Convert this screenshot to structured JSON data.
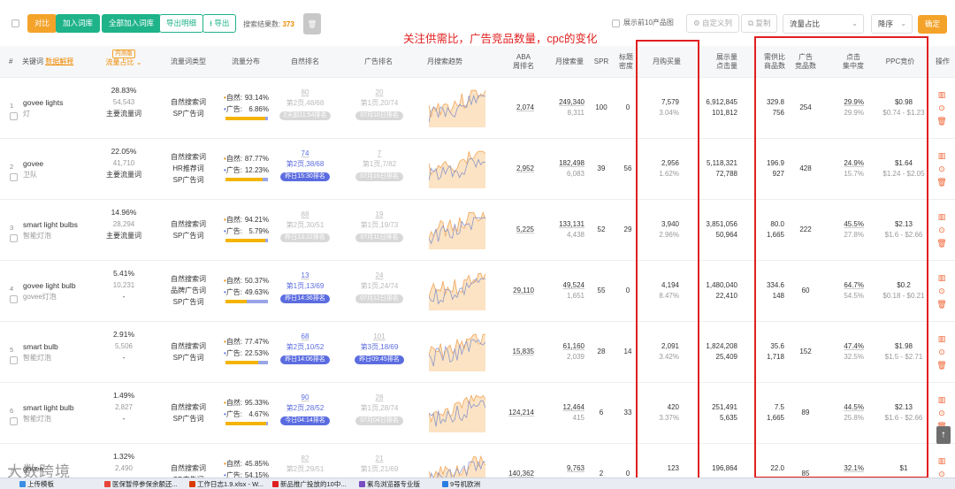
{
  "toolbar": {
    "compare": "对比",
    "add_to_lib": "加入词库",
    "add_all_to_lib": "全部加入词库",
    "export_detail": "导出明细",
    "export": "导出",
    "result_count_label": "搜索结果数:",
    "result_count": "373",
    "show_top10": "展示前10产品图",
    "custom_columns": "自定义列",
    "copy": "复制",
    "sort_field": "流量占比",
    "sort_order": "降序",
    "confirm": "确定"
  },
  "annotation": "关注供需比，广告竞品数量，cpc的变化",
  "headers": {
    "index": "#",
    "keyword": "关键词",
    "data_explain": "数据解释",
    "traffic_share_tag": "内测版",
    "traffic_share": "流量占比",
    "traffic_type": "流量词类型",
    "traffic_dist": "流量分布",
    "organic_rank": "自然排名",
    "ad_rank": "广告排名",
    "monthly_trend": "月搜索趋势",
    "aba_1": "ABA",
    "aba_2": "周排名",
    "monthly_search": "月搜索量",
    "spr": "SPR",
    "title_density_1": "标题",
    "title_density_2": "密度",
    "monthly_purchase": "月购买量",
    "impressions_1": "展示量",
    "impressions_2": "点击量",
    "supply_demand_1": "需供比",
    "supply_demand_2": "商品数",
    "ad_products_1": "广告",
    "ad_products_2": "竞品数",
    "click_conc_1": "点击",
    "click_conc_2": "集中度",
    "ppc": "PPC竞价",
    "actions": "操作"
  },
  "rows": [
    {
      "idx": "1",
      "kw": "govee lights",
      "cn": "灯",
      "share": "28.83%",
      "share_num": "54,543",
      "main": "主要流量词",
      "types": [
        "自然搜索词",
        "SP广告词"
      ],
      "nat_label": "自然:",
      "nat": "93.14%",
      "ad_label": "广告:",
      "ad": "6.86%",
      "ad_frac": 0.0686,
      "or1": "80",
      "or2": "第2页,48/68",
      "or3": "2天前11:54排名",
      "or_active": false,
      "ar1": "20",
      "ar2": "第1页,20/74",
      "ar3": "07月10日排名",
      "ar_active": false,
      "aba": "2,074",
      "ms": "249,340",
      "ms2": "8,311",
      "spr": "100",
      "td": "0",
      "mp": "7,579",
      "mp2": "3.04%",
      "imp": "6,912,845",
      "clk": "101,812",
      "sd": "329.8",
      "prod": "756",
      "adc": "254",
      "cc": "29.9%",
      "cc2": "29.9%",
      "ppc": "$0.98",
      "ppc2": "$0.74 - $1.23"
    },
    {
      "idx": "2",
      "kw": "govee",
      "cn": "卫队",
      "share": "22.05%",
      "share_num": "41,710",
      "main": "主要流量词",
      "types": [
        "自然搜索词",
        "HR推荐词",
        "SP广告词"
      ],
      "nat_label": "自然:",
      "nat": "87.77%",
      "ad_label": "广告:",
      "ad": "12.23%",
      "ad_frac": 0.1223,
      "or1": "74",
      "or2": "第2页,38/68",
      "or3": "昨日15:30排名",
      "or_active": true,
      "ar1": "7",
      "ar2": "第1页,7/82",
      "ar3": "07月16日排名",
      "ar_active": false,
      "aba": "2,952",
      "ms": "182,498",
      "ms2": "6,083",
      "spr": "39",
      "td": "56",
      "mp": "2,956",
      "mp2": "1.62%",
      "imp": "5,118,321",
      "clk": "72,788",
      "sd": "196.9",
      "prod": "927",
      "adc": "428",
      "cc": "24.9%",
      "cc2": "15.7%",
      "ppc": "$1.64",
      "ppc2": "$1.24 - $2.05"
    },
    {
      "idx": "3",
      "kw": "smart light bulbs",
      "cn": "智能灯泡",
      "share": "14.96%",
      "share_num": "28,294",
      "main": "主要流量词",
      "types": [
        "自然搜索词",
        "SP广告词"
      ],
      "nat_label": "自然:",
      "nat": "94.21%",
      "ad_label": "广告:",
      "ad": "5.79%",
      "ad_frac": 0.0579,
      "or1": "88",
      "or2": "第2页,30/51",
      "or3": "昨日13:22排名",
      "or_active": false,
      "ar1": "19",
      "ar2": "第1页,19/73",
      "ar3": "07月11日排名",
      "ar_active": false,
      "aba": "5,225",
      "ms": "133,131",
      "ms2": "4,438",
      "spr": "52",
      "td": "29",
      "mp": "3,940",
      "mp2": "2.96%",
      "imp": "3,851,056",
      "clk": "50,964",
      "sd": "80.0",
      "prod": "1,665",
      "adc": "222",
      "cc": "45.5%",
      "cc2": "27.8%",
      "ppc": "$2.13",
      "ppc2": "$1.6 - $2.66"
    },
    {
      "idx": "4",
      "kw": "govee light bulb",
      "cn": "govee灯泡",
      "share": "5.41%",
      "share_num": "10,231",
      "main": "-",
      "types": [
        "自然搜索词",
        "品牌广告词",
        "SP广告词"
      ],
      "nat_label": "自然:",
      "nat": "50.37%",
      "ad_label": "广告:",
      "ad": "49.63%",
      "ad_frac": 0.4963,
      "or1": "13",
      "or2": "第1页,13/69",
      "or3": "昨日14:36排名",
      "or_active": true,
      "ar1": "24",
      "ar2": "第1页,24/74",
      "ar3": "07月12日排名",
      "ar_active": false,
      "aba": "29,110",
      "ms": "49,524",
      "ms2": "1,651",
      "spr": "55",
      "td": "0",
      "mp": "4,194",
      "mp2": "8.47%",
      "imp": "1,480,040",
      "clk": "22,410",
      "sd": "334.6",
      "prod": "148",
      "adc": "60",
      "cc": "64.7%",
      "cc2": "54.5%",
      "ppc": "$0.2",
      "ppc2": "$0.18 - $0.21"
    },
    {
      "idx": "5",
      "kw": "smart bulb",
      "cn": "智能灯泡",
      "share": "2.91%",
      "share_num": "5,506",
      "main": "-",
      "types": [
        "自然搜索词",
        "SP广告词"
      ],
      "nat_label": "自然:",
      "nat": "77.47%",
      "ad_label": "广告:",
      "ad": "22.53%",
      "ad_frac": 0.2253,
      "or1": "68",
      "or2": "第2页,10/52",
      "or3": "昨日14:06排名",
      "or_active": true,
      "ar1": "101",
      "ar2": "第3页,18/69",
      "ar3": "昨日09:45排名",
      "ar_active": true,
      "aba": "15,835",
      "ms": "61,160",
      "ms2": "2,039",
      "spr": "28",
      "td": "14",
      "mp": "2,091",
      "mp2": "3.42%",
      "imp": "1,824,208",
      "clk": "25,409",
      "sd": "35.6",
      "prod": "1,718",
      "adc": "152",
      "cc": "47.4%",
      "cc2": "32.5%",
      "ppc": "$1.98",
      "ppc2": "$1.5 - $2.71"
    },
    {
      "idx": "6",
      "kw": "smart light bulb",
      "cn": "智能灯泡",
      "share": "1.49%",
      "share_num": "2,827",
      "main": "-",
      "types": [
        "自然搜索词",
        "SP广告词"
      ],
      "nat_label": "自然:",
      "nat": "95.33%",
      "ad_label": "广告:",
      "ad": "4.67%",
      "ad_frac": 0.0467,
      "or1": "90",
      "or2": "第2页,28/52",
      "or3": "今日04:14排名",
      "or_active": true,
      "ar1": "28",
      "ar2": "第1页,28/74",
      "ar3": "07月04日排名",
      "ar_active": false,
      "aba": "124,214",
      "ms": "12,464",
      "ms2": "415",
      "spr": "6",
      "td": "33",
      "mp": "420",
      "mp2": "3.37%",
      "imp": "251,491",
      "clk": "5,635",
      "sd": "7.5",
      "prod": "1,665",
      "adc": "89",
      "cc": "44.5%",
      "cc2": "25.8%",
      "ppc": "$2.13",
      "ppc2": "$1.6 - $2.66"
    },
    {
      "idx": "7",
      "kw": "govee",
      "cn": "",
      "share": "1.32%",
      "share_num": "2,490",
      "main": "",
      "types": [
        "自然搜索词",
        "SP广告词"
      ],
      "nat_label": "自然:",
      "nat": "45.85%",
      "ad_label": "广告:",
      "ad": "54.15%",
      "ad_frac": 0.5415,
      "or1": "82",
      "or2": "第2页,29/51",
      "or3": "",
      "or_active": false,
      "ar1": "21",
      "ar2": "第1页,21/69",
      "ar3": "",
      "ar_active": false,
      "aba": "140,362",
      "ms": "9,763",
      "ms2": "",
      "spr": "2",
      "td": "0",
      "mp": "123",
      "mp2": "",
      "imp": "196,864",
      "clk": "",
      "sd": "22.0",
      "prod": "",
      "adc": "85",
      "cc": "32.1%",
      "cc2": "",
      "ppc": "$1",
      "ppc2": ""
    }
  ],
  "taskbar": [
    {
      "label": "上传模板",
      "icon_color": "#3a8ee6",
      "icon": "folder-icon"
    },
    {
      "label": "医保暂停参保余额还...",
      "icon_color": "#e8443a",
      "icon": "browser-icon"
    },
    {
      "label": "工作日志1.9.xlsx - W...",
      "icon_color": "#d83b01",
      "icon": "wps-icon"
    },
    {
      "label": "新品推广投放的10中...",
      "icon_color": "#e02020",
      "icon": "doc-icon"
    },
    {
      "label": "紫鸟浏览器专业版",
      "icon_color": "#7a4cc2",
      "icon": "browser-icon"
    },
    {
      "label": "9号机欧洲",
      "icon_color": "#2a7de1",
      "icon": "window-icon"
    }
  ],
  "watermark": "大数跨境",
  "colors": {
    "accent": "#f4a32a",
    "green": "#1fb38a",
    "annotation_red": "#e02020",
    "natural_bar": "#f4b400",
    "ad_bar": "#9aa5e8",
    "rank_badge": "#5b6ce0"
  }
}
